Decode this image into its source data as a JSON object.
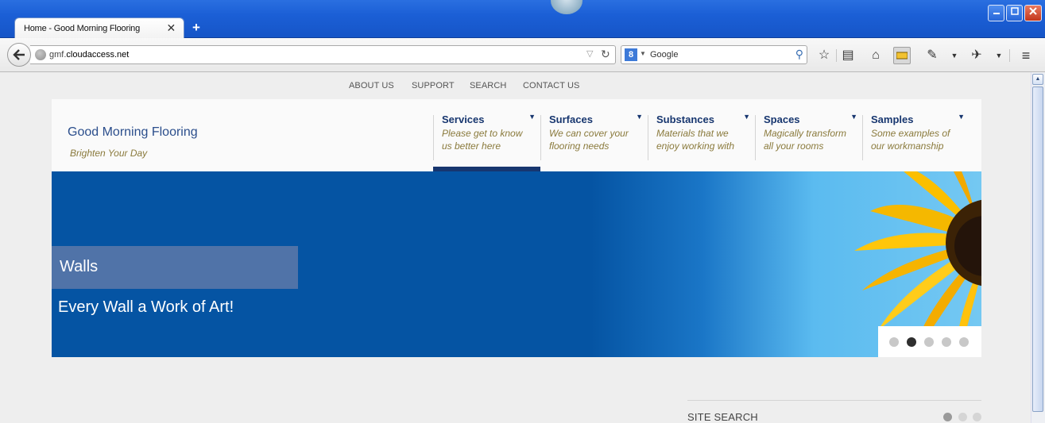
{
  "browser": {
    "tab_title": "Home - Good Morning Flooring",
    "tab_close": "✕",
    "new_tab": "+",
    "url_scheme": "gmf.",
    "url_host": "cloudaccess.net",
    "search_engine_letter": "8",
    "search_placeholder": "Google",
    "window_buttons": [
      "minimize",
      "maximize",
      "close"
    ]
  },
  "top_links": [
    "ABOUT US",
    "SUPPORT",
    "SEARCH",
    "CONTACT US"
  ],
  "site": {
    "title": "Good Morning Flooring",
    "tagline": "Brighten Your Day"
  },
  "main_nav": [
    {
      "title": "Services",
      "subtitle_1": "Please get to know",
      "subtitle_2": "us better here"
    },
    {
      "title": "Surfaces",
      "subtitle_1": "We can cover your",
      "subtitle_2": "flooring needs"
    },
    {
      "title": "Substances",
      "subtitle_1": "Materials that we",
      "subtitle_2": "enjoy working with"
    },
    {
      "title": "Spaces",
      "subtitle_1": "Magically transform",
      "subtitle_2": "all your rooms"
    },
    {
      "title": "Samples",
      "subtitle_1": "Some examples of",
      "subtitle_2": "our workmanship"
    }
  ],
  "hero": {
    "label": "Walls",
    "caption": "Every Wall a Work of Art!",
    "slide_count": 5,
    "active_slide": 2
  },
  "sidebar": {
    "title": "SITE SEARCH",
    "dot_count": 3,
    "active_dot": 1
  },
  "colors": {
    "hero_blue": "#0554a3",
    "nav_text": "#17366f",
    "accent_italic": "#8a7a3c"
  }
}
